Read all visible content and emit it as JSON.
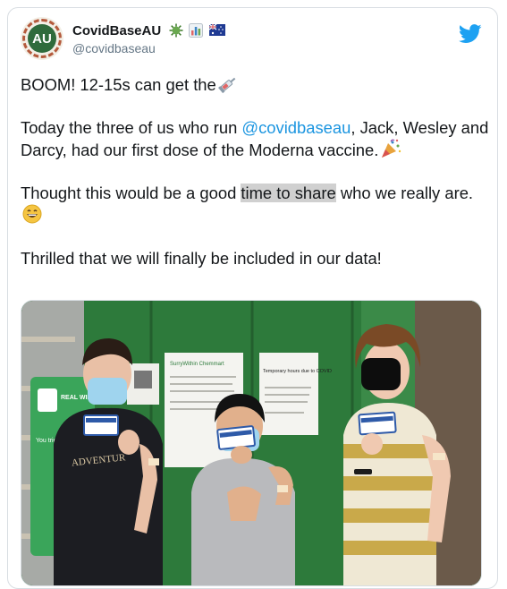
{
  "tweet": {
    "display_name": "CovidBaseAU",
    "handle": "@covidbaseau",
    "avatar_text": "AU",
    "badges": [
      "virus-icon",
      "bar-chart-icon",
      "australia-flag-icon"
    ],
    "paragraph1_text": "BOOM! 12-15s can get the",
    "paragraph1_emoji": "syringe-icon",
    "paragraph2_before": "Today the three of us who run ",
    "paragraph2_mention": "@covidbaseau",
    "paragraph2_after": ", Jack, Wesley and Darcy, had our first dose of the Moderna vaccine.",
    "paragraph2_emoji": "party-popper-icon",
    "paragraph3_before": "Thought this would be a good ",
    "paragraph3_highlight": "time to share",
    "paragraph3_after": " who we really are.",
    "paragraph3_emoji": "grinning-face-icon",
    "paragraph4_text": "Thrilled that we will finally be included in our data!"
  },
  "media": {
    "sign_left_title": "SurryWithin Chemmart",
    "sign_right_title": "Temporary hours due to COVID",
    "promo_title": "REAL WINTER DEFENCE",
    "promo_sub": "You tried ency of",
    "shirt_text": "ADVENTUR",
    "card_text": "COVID-19 Vaccination"
  },
  "colors": {
    "mention": "#1b95e0",
    "twitter_blue": "#1da1f2",
    "wall_green": "#2d7a3b"
  }
}
